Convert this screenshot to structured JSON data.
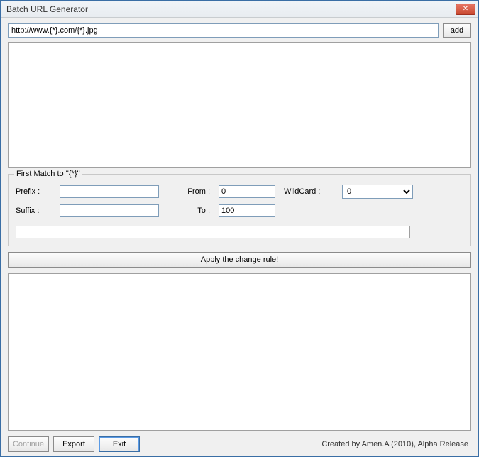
{
  "window": {
    "title": "Batch URL Generator"
  },
  "url_row": {
    "value": "http://www.{*}.com/{*}.jpg",
    "add_label": "add"
  },
  "fieldset": {
    "legend": "First Match to ''{*}''",
    "prefix_label": "Prefix :",
    "prefix_value": "",
    "suffix_label": "Suffix :",
    "suffix_value": "",
    "from_label": "From :",
    "from_value": "0",
    "to_label": "To :",
    "to_value": "100",
    "wildcard_label": "WildCard :",
    "wildcard_value": "0",
    "long_input_value": ""
  },
  "apply_label": "Apply the change rule!",
  "footer": {
    "continue_label": "Continue",
    "export_label": "Export",
    "exit_label": "Exit",
    "credit": "Created by Amen.A (2010), Alpha Release"
  }
}
